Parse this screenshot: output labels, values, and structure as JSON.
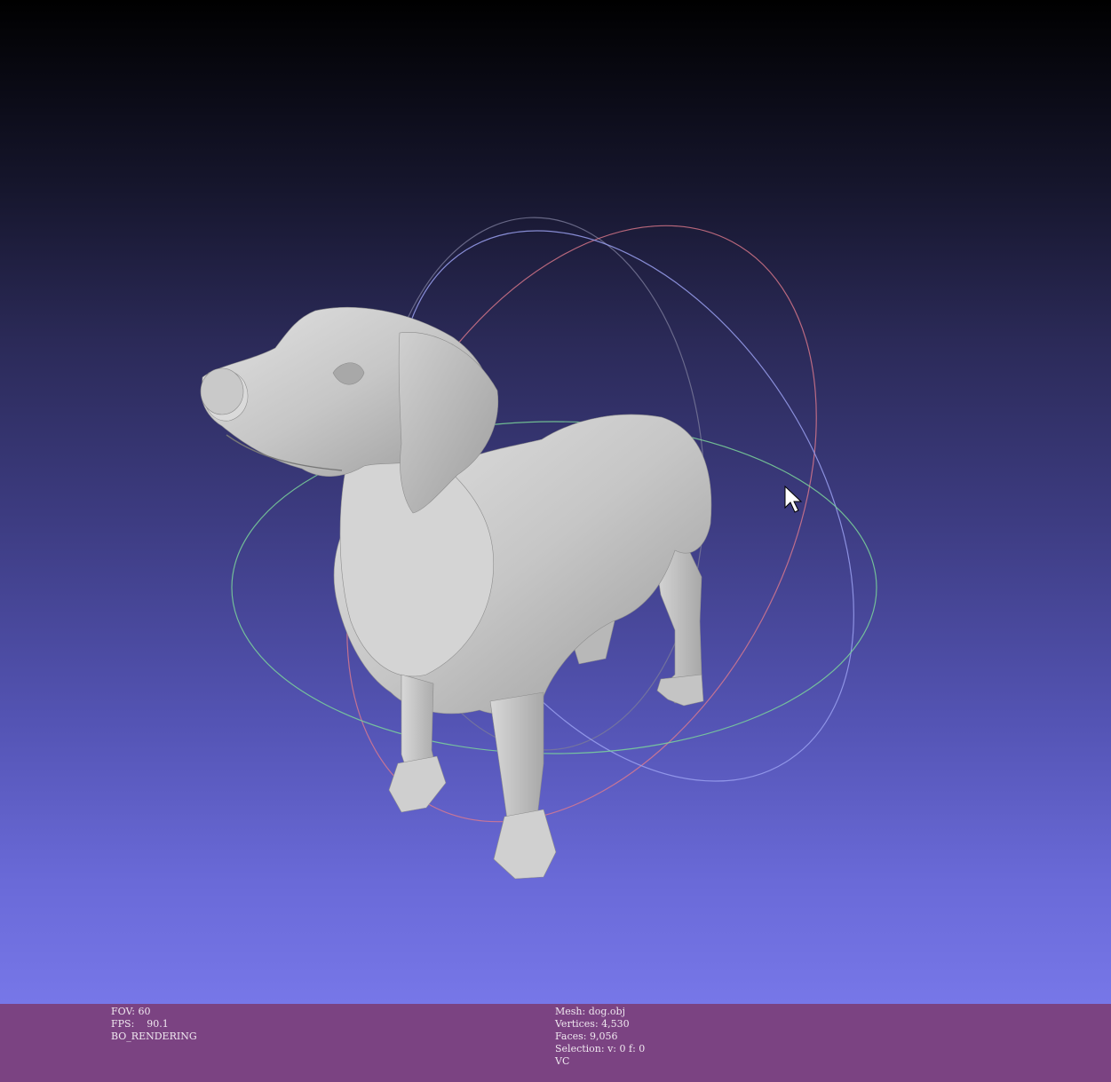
{
  "viewer": {
    "status_left": {
      "fov_label": "FOV:",
      "fov_value": "60",
      "fps_label": "FPS:",
      "fps_value": "90.1",
      "render_mode": "BO_RENDERING"
    },
    "status_right": {
      "mesh": "Mesh: dog.obj",
      "vertices": "Vertices: 4,530",
      "faces": "Faces: 9,056",
      "selection": "Selection: v: 0 f: 0",
      "color_mode": "VC"
    },
    "colors": {
      "background_top": "#000000",
      "background_bottom": "#7777e8",
      "info_bar": "#7b4382",
      "mesh": "#c8c8c8",
      "trackball_x": "#e07b8c",
      "trackball_y": "#7bd39a",
      "trackball_z": "#9aa0f0"
    },
    "icons": {
      "cursor": "arrow-cursor-icon",
      "trackball": "trackball-gizmo-icon"
    }
  }
}
